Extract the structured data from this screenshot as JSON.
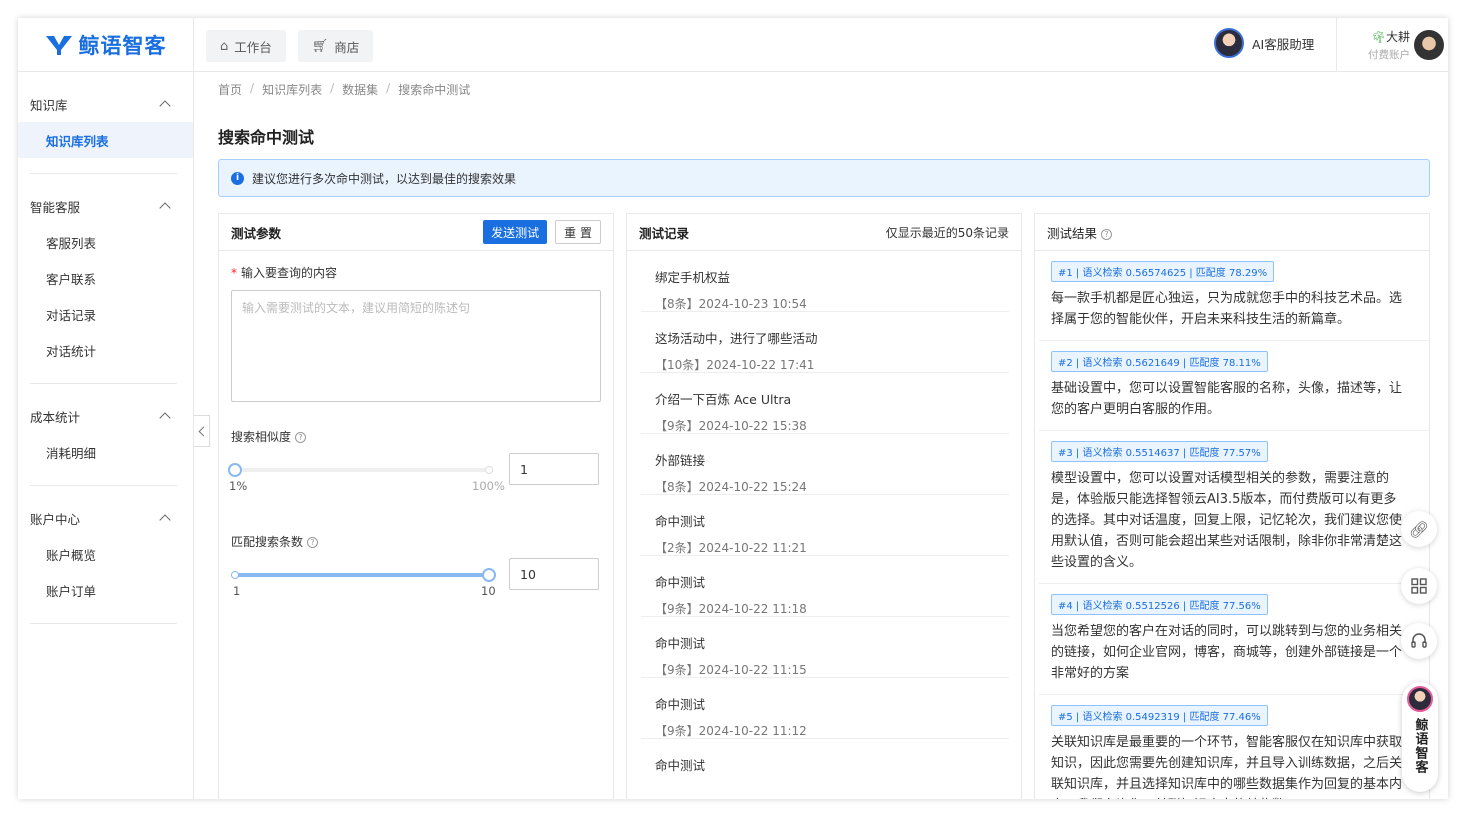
{
  "header": {
    "logo_text": "鲸语智客",
    "tabs": [
      {
        "icon": "home-icon",
        "label": "工作台"
      },
      {
        "icon": "cart-icon",
        "label": "商店"
      }
    ],
    "assistant_label": "AI客服助理",
    "user_name": "大耕",
    "user_sub": "付费账户"
  },
  "sidebar": {
    "groups": [
      {
        "title": "知识库",
        "items": [
          "知识库列表"
        ]
      },
      {
        "title": "智能客服",
        "items": [
          "客服列表",
          "客户联系",
          "对话记录",
          "对话统计"
        ]
      },
      {
        "title": "成本统计",
        "items": [
          "消耗明细"
        ]
      },
      {
        "title": "账户中心",
        "items": [
          "账户概览",
          "账户订单"
        ]
      }
    ],
    "active_item": "知识库列表"
  },
  "breadcrumb": [
    "首页",
    "知识库列表",
    "数据集",
    "搜索命中测试"
  ],
  "page_title": "搜索命中测试",
  "alert": "建议您进行多次命中测试，以达到最佳的搜索效果",
  "params": {
    "title": "测试参数",
    "send_label": "发送测试",
    "reset_label": "重 置",
    "query_label": "输入要查询的内容",
    "query_placeholder": "输入需要测试的文本，建议用简短的陈述句",
    "query_value": "",
    "similarity_label": "搜索相似度",
    "similarity_min_label": "1%",
    "similarity_max_label": "100%",
    "similarity_value": "1",
    "similarity_fraction": 0.0,
    "count_label": "匹配搜索条数",
    "count_min_label": "1",
    "count_max_label": "10",
    "count_value": "10",
    "count_fraction": 1.0
  },
  "records": {
    "title": "测试记录",
    "note": "仅显示最近的50条记录",
    "items": [
      {
        "query": "绑定手机权益",
        "meta": "【8条】2024-10-23 10:54"
      },
      {
        "query": "这场活动中，进行了哪些活动",
        "meta": "【10条】2024-10-22 17:41"
      },
      {
        "query": "介绍一下百炼 Ace Ultra",
        "meta": "【9条】2024-10-22 15:38"
      },
      {
        "query": "外部链接",
        "meta": "【8条】2024-10-22 15:24"
      },
      {
        "query": "命中测试",
        "meta": "【2条】2024-10-22 11:21"
      },
      {
        "query": "命中测试",
        "meta": "【9条】2024-10-22 11:18"
      },
      {
        "query": "命中测试",
        "meta": "【9条】2024-10-22 11:15"
      },
      {
        "query": "命中测试",
        "meta": "【9条】2024-10-22 11:12"
      },
      {
        "query": "命中测试",
        "meta": ""
      }
    ]
  },
  "results": {
    "title": "测试结果",
    "items": [
      {
        "tag": "#1 | 语义检索 0.56574625 | 匹配度 78.29%",
        "text": "每一款手机都是匠心独运，只为成就您手中的科技艺术品。选择属于您的智能伙伴，开启未来科技生活的新篇章。"
      },
      {
        "tag": "#2 | 语义检索 0.5621649 | 匹配度 78.11%",
        "text": "基础设置中，您可以设置智能客服的名称，头像，描述等，让您的客户更明白客服的作用。"
      },
      {
        "tag": "#3 | 语义检索 0.5514637 | 匹配度 77.57%",
        "text": "模型设置中，您可以设置对话模型相关的参数，需要注意的是，体验版只能选择智领云AI3.5版本，而付费版可以有更多的选择。其中对话温度，回复上限，记忆轮次，我们建议您使用默认值，否则可能会超出某些对话限制，除非你非常清楚这些设置的含义。"
      },
      {
        "tag": "#4 | 语义检索 0.5512526 | 匹配度 77.56%",
        "text": "当您希望您的客户在对话的同时，可以跳转到与您的业务相关的链接，如何企业官网，博客，商城等，创建外部链接是一个非常好的方案"
      },
      {
        "tag": "#5 | 语义检索 0.5492319 | 匹配度 77.46%",
        "text": "关联知识库是最重要的一个环节，智能客服仅在知识库中获取知识，因此您需要先创建知识库，并且导入训练数据，之后关联知识库，并且选择知识库中的哪些数据集作为回复的基本内容。我们允许您只关联知识库中的某些数"
      }
    ]
  },
  "float": {
    "brand_text": "鲸语智客"
  },
  "colors": {
    "primary": "#1a6fe0",
    "alert_bg": "#eaf4ff",
    "slider": "#8ab8f0"
  }
}
